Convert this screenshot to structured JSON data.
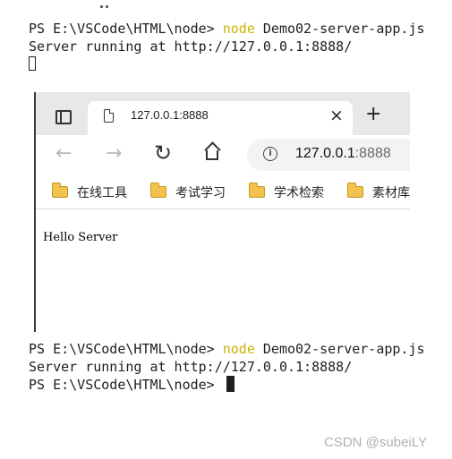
{
  "terminal_top": {
    "line1": {
      "prompt": "PS E:\\VSCode\\HTML\\node> ",
      "command": "node",
      "args": " Demo02-server-app.js"
    },
    "line2": "Server running at http://127.0.0.1:8888/"
  },
  "browser": {
    "tab": {
      "title": "127.0.0.1:8888",
      "close": "×"
    },
    "new_tab": "+",
    "nav": {
      "back": "←",
      "forward": "→",
      "refresh": "↻"
    },
    "address": {
      "info": "i",
      "host": "127.0.0.1",
      "port": ":8888"
    },
    "bookmarks": [
      {
        "label": "在线工具"
      },
      {
        "label": "考试学习"
      },
      {
        "label": "学术检索"
      },
      {
        "label": "素材库"
      }
    ],
    "page_text": "Hello Server"
  },
  "terminal_bottom": {
    "line1": {
      "prompt": "PS E:\\VSCode\\HTML\\node> ",
      "command": "node",
      "args": " Demo02-server-app.js"
    },
    "line2": "Server running at http://127.0.0.1:8888/",
    "line3": "PS E:\\VSCode\\HTML\\node> "
  },
  "watermark": "CSDN @subeiLY"
}
